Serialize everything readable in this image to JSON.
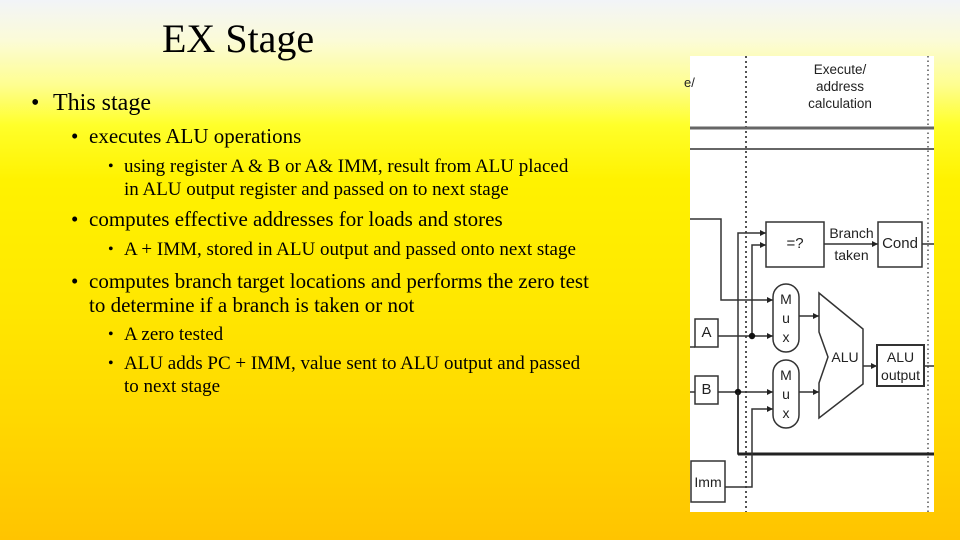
{
  "slide": {
    "title": "EX Stage",
    "bullets": [
      {
        "level": 1,
        "text": "This stage"
      },
      {
        "level": 2,
        "text": "executes ALU operations"
      },
      {
        "level": 3,
        "lines": [
          "using register A & B or A& IMM, result from ALU placed",
          "in ALU output register and passed on to next stage"
        ]
      },
      {
        "level": 2,
        "text": "computes effective addresses for loads and stores"
      },
      {
        "level": 3,
        "text": "A + IMM, stored in ALU output and passed onto next stage"
      },
      {
        "level": 2,
        "lines": [
          "computes branch target locations and performs the zero test",
          "to determine if a branch is taken or not"
        ]
      },
      {
        "level": 3,
        "text": "A zero tested"
      },
      {
        "level": 3,
        "lines": [
          "ALU adds PC + IMM, value sent to ALU output and passed",
          "to next stage"
        ]
      }
    ],
    "bullet_glyph": "•"
  },
  "diagram": {
    "stage_header": [
      "Execute/",
      "address",
      "calculation"
    ],
    "prev_stage_fragment": "e/",
    "zero_test_label": "=?",
    "branch_label": [
      "Branch",
      "taken"
    ],
    "cond_label": "Cond",
    "mux_label": [
      "M",
      "u",
      "x"
    ],
    "alu_label": "ALU",
    "alu_output_label": [
      "ALU",
      "output"
    ],
    "reg_a_label": "A",
    "reg_b_label": "B",
    "imm_label": "Imm"
  }
}
